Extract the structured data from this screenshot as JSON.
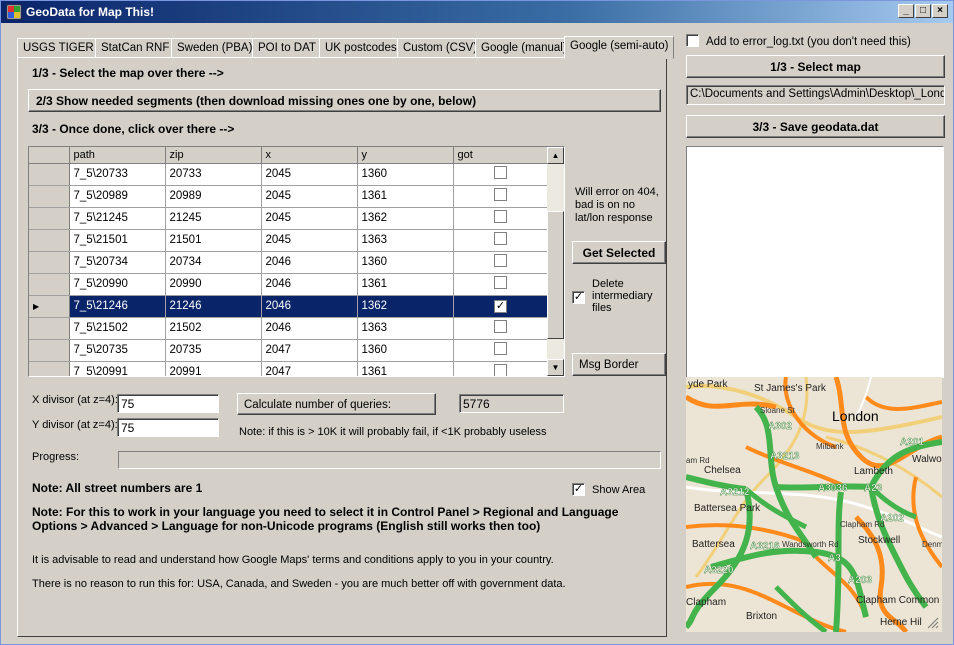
{
  "window": {
    "title": "GeoData for Map This!"
  },
  "tabs": [
    "USGS TIGER",
    "StatCan RNF",
    "Sweden (PBA)",
    "POI to DAT",
    "UK postcodes",
    "Custom (CSV)",
    "Google (manual)",
    "Google (semi-auto)"
  ],
  "active_tab": 7,
  "steps": {
    "step1": "1/3 - Select the map over there -->",
    "step2": "2/3 Show needed segments (then download missing ones one by one, below)",
    "step3": "3/3 - Once done, click over there -->"
  },
  "grid": {
    "columns": [
      "path",
      "zip",
      "x",
      "y",
      "got"
    ],
    "rows": [
      {
        "path": "7_5\\20733",
        "zip": "20733",
        "x": "2045",
        "y": "1360",
        "got": false
      },
      {
        "path": "7_5\\20989",
        "zip": "20989",
        "x": "2045",
        "y": "1361",
        "got": false
      },
      {
        "path": "7_5\\21245",
        "zip": "21245",
        "x": "2045",
        "y": "1362",
        "got": false
      },
      {
        "path": "7_5\\21501",
        "zip": "21501",
        "x": "2045",
        "y": "1363",
        "got": false
      },
      {
        "path": "7_5\\20734",
        "zip": "20734",
        "x": "2046",
        "y": "1360",
        "got": false
      },
      {
        "path": "7_5\\20990",
        "zip": "20990",
        "x": "2046",
        "y": "1361",
        "got": false
      },
      {
        "path": "7_5\\21246",
        "zip": "21246",
        "x": "2046",
        "y": "1362",
        "got": true,
        "selected": true
      },
      {
        "path": "7_5\\21502",
        "zip": "21502",
        "x": "2046",
        "y": "1363",
        "got": false
      },
      {
        "path": "7_5\\20735",
        "zip": "20735",
        "x": "2047",
        "y": "1360",
        "got": false
      },
      {
        "path": "7_5\\20991",
        "zip": "20991",
        "x": "2047",
        "y": "1361",
        "got": false
      }
    ]
  },
  "side": {
    "error_note": "Will error on 404, bad is on no lat/lon response",
    "get_selected": "Get Selected",
    "delete_label": "Delete intermediary files",
    "delete_checked": true,
    "msg_border": "Msg Border"
  },
  "divisors": {
    "x_label": "X divisor (at z=4):",
    "x_value": "75",
    "y_label": "Y divisor (at z=4):",
    "y_value": "75",
    "calc_button": "Calculate number of queries:",
    "calc_result": "5776",
    "note": "Note: if this is > 10K it will probably fail, if <1K probably useless"
  },
  "progress": {
    "label": "Progress:",
    "value": 0
  },
  "notes": {
    "street": "Note: All street numbers are 1",
    "show_area": "Show Area",
    "show_area_checked": true,
    "language": "Note: For this to work in your language you need to select it in Control Panel > Regional and Language Options > Advanced > Language for non-Unicode programs (English still works then too)",
    "advisable": "It is advisable to read and understand how Google Maps' terms and conditions apply to you in your country.",
    "no_reason": "There is no reason to run this for: USA, Canada, and Sweden - you are much better off with government data."
  },
  "right": {
    "error_log_label": "Add to error_log.txt (you don't need this)",
    "error_log_checked": false,
    "select_map": "1/3 - Select map",
    "path_value": "C:\\Documents and Settings\\Admin\\Desktop\\_London",
    "save": "3/3 - Save geodata.dat"
  },
  "map": {
    "labels": [
      "yde Park",
      "St James's Park",
      "London",
      "A302",
      "A3213",
      "Milbank",
      "A201",
      "Chelsea",
      "Lambeth",
      "Walwo",
      "A3212",
      "A3036",
      "A23",
      "Battersea Park",
      "A202",
      "Battersea",
      "A3216",
      "Stockwell",
      "A3220",
      "A3",
      "A203",
      "Clapham",
      "Clapham Common",
      "Brixton",
      "Herne Hil",
      "Sloane St",
      "Wandsworth Rd",
      "Clapham Rd",
      "Denmark Hil",
      "am Rd"
    ]
  }
}
